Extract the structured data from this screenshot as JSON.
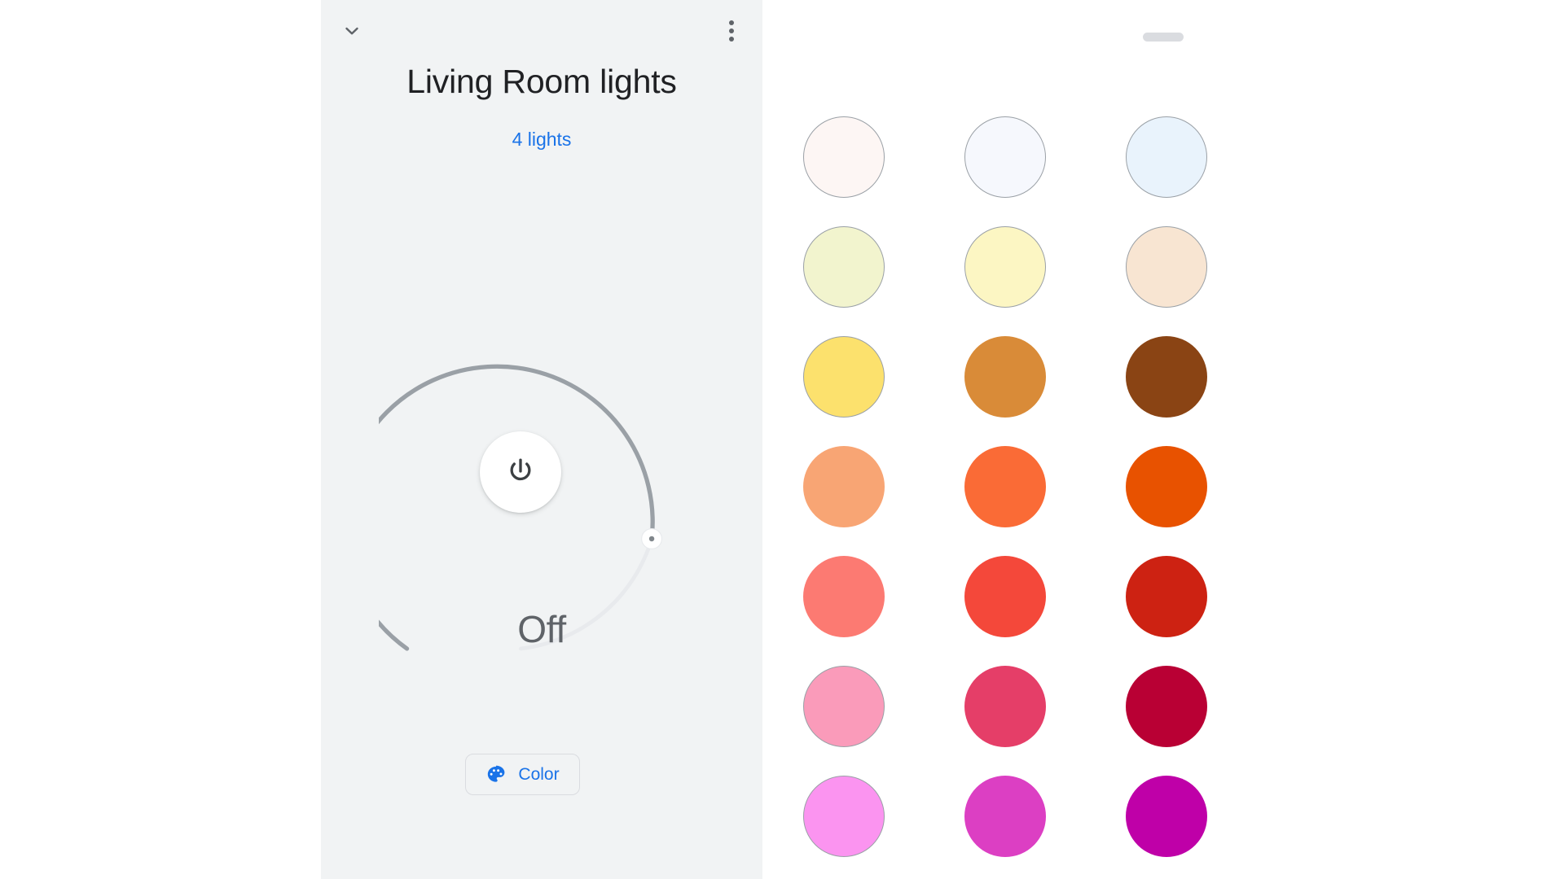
{
  "app": {
    "background_color": "#ffffff",
    "panel_color": "#f1f3f4",
    "accent_color": "#1a73e8",
    "muted_text_color": "#5f6368"
  },
  "device_panel": {
    "collapse_icon": "chevron-down-icon",
    "overflow_icon": "more-vert-icon",
    "title": "Living Room lights",
    "subtitle": "4 lights",
    "dial": {
      "state_label": "Off",
      "power_icon": "power-icon",
      "track_color": "#e8eaed",
      "filled_color": "#9aa0a6",
      "handle_position_degrees": 135,
      "arc_start_degrees": -120,
      "arc_end_degrees": 120,
      "value_percent": 85
    },
    "color_chip": {
      "icon": "palette-icon",
      "label": "Color"
    }
  },
  "color_sheet": {
    "handle": "drag-handle",
    "columns": 3,
    "rows": 7,
    "swatches": [
      {
        "name": "warm-white",
        "hex": "#fdf6f4",
        "outlined": true
      },
      {
        "name": "cool-white",
        "hex": "#f6f8fd",
        "outlined": true
      },
      {
        "name": "ice-blue",
        "hex": "#e9f3fc",
        "outlined": true
      },
      {
        "name": "pale-lime",
        "hex": "#f2f4ce",
        "outlined": true
      },
      {
        "name": "pale-yellow",
        "hex": "#fcf6c3",
        "outlined": true
      },
      {
        "name": "pale-peach",
        "hex": "#f8e5d2",
        "outlined": true
      },
      {
        "name": "yellow",
        "hex": "#fce16d",
        "outlined": true
      },
      {
        "name": "amber",
        "hex": "#d98b38",
        "outlined": false
      },
      {
        "name": "brown",
        "hex": "#8a4414",
        "outlined": false
      },
      {
        "name": "light-salmon",
        "hex": "#f8a574",
        "outlined": false
      },
      {
        "name": "orange",
        "hex": "#fa6b36",
        "outlined": false
      },
      {
        "name": "deep-orange",
        "hex": "#e85200",
        "outlined": false
      },
      {
        "name": "coral",
        "hex": "#fc7a72",
        "outlined": false
      },
      {
        "name": "red",
        "hex": "#f4483a",
        "outlined": false
      },
      {
        "name": "dark-red",
        "hex": "#cd2212",
        "outlined": false
      },
      {
        "name": "pink",
        "hex": "#fa9bba",
        "outlined": true
      },
      {
        "name": "deep-pink",
        "hex": "#e53e68",
        "outlined": false
      },
      {
        "name": "crimson",
        "hex": "#b90034",
        "outlined": false
      },
      {
        "name": "light-magenta",
        "hex": "#fb94f0",
        "outlined": true
      },
      {
        "name": "magenta",
        "hex": "#dc3fc3",
        "outlined": false
      },
      {
        "name": "deep-magenta",
        "hex": "#bf00a8",
        "outlined": false
      }
    ]
  }
}
